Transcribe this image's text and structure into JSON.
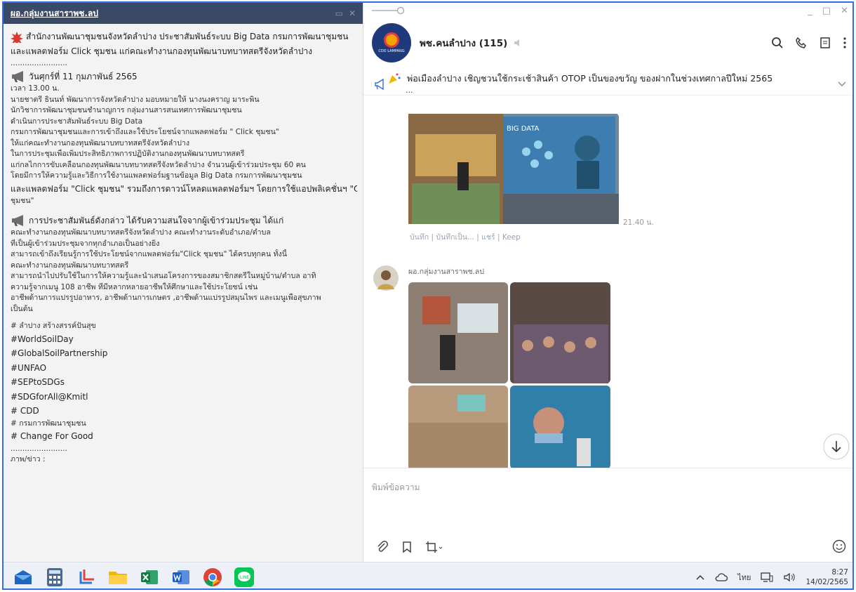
{
  "note_window": {
    "title": "ผอ.กลุ่มงานสาราพช.ลป",
    "lines": [
      {
        "kind": "big",
        "icon": "starburst",
        "text": "สำนักงานพัฒนาชุมชนจังหวัดลำปาง ประชาสัมพันธ์ระบบ Big Data กรมการพัฒนาชุมชน"
      },
      {
        "kind": "big",
        "icon": "",
        "text": "และแพลตฟอร์ม Click ชุมชน แก่คณะทำงานกองทุนพัฒนาบทบาทสตรีจังหวัดลำปาง"
      },
      {
        "kind": "normal",
        "icon": "",
        "text": "........................"
      },
      {
        "kind": "big",
        "icon": "megaphone",
        "text": "วันศุกร์ที่ 11 กุมภาพันธ์ 2565"
      },
      {
        "kind": "normal",
        "icon": "",
        "text": "เวลา 13.00 น."
      },
      {
        "kind": "normal",
        "icon": "",
        "text": "นายชาตรี ธินนท์ พัฒนาการจังหวัดลำปาง มอบหมายให้ นางนงคราญ มาระพิน"
      },
      {
        "kind": "normal",
        "icon": "",
        "text": "นักวิชาการพัฒนาชุมชนชำนาญการ กลุ่มงานสารสนเทศการพัฒนาชุมชน"
      },
      {
        "kind": "normal",
        "icon": "",
        "text": "ดำเนินการประชาสัมพันธ์ระบบ Big Data"
      },
      {
        "kind": "normal",
        "icon": "",
        "text": "กรมการพัฒนาชุมชนและการเข้าถึงและใช้ประโยชน์จากแพลตฟอร์ม \" Click ชุมชน\""
      },
      {
        "kind": "normal",
        "icon": "",
        "text": "ให้แก่คณะทำงานกองทุนพัฒนาบทบาทสตรีจังหวัดลำปาง"
      },
      {
        "kind": "normal",
        "icon": "",
        "text": "ในการประชุมเพื่อเพิ่มประสิทธิภาพการปฏิบัติงานกองทุนพัฒนาบทบาทสตรี"
      },
      {
        "kind": "normal",
        "icon": "",
        "text": "แก่กลไกการขับเคลื่อนกองทุนพัฒนาบทบาทสตรีจังหวัดลำปาง จำนวนผู้เข้าร่วมประชุม 60 คน"
      },
      {
        "kind": "normal",
        "icon": "",
        "text": "โดยมีการให้ความรู้และวิธีการใช้งานแพลตฟอร์มฐานข้อมูล Big Data กรมการพัฒนาชุมชน"
      },
      {
        "kind": "big",
        "icon": "",
        "text": "และแพลตฟอร์ม \"Click ชุมชน\" รวมถึงการดาวน์โหลดแพลตฟอร์มฯ โดยการใช้แอปพลิเคชั่นฯ \"Click"
      },
      {
        "kind": "normal",
        "icon": "",
        "text": "ชุมชน\""
      },
      {
        "kind": "gap",
        "icon": "",
        "text": ""
      },
      {
        "kind": "big",
        "icon": "megaphone",
        "text": "การประชาสัมพันธ์ดังกล่าว ได้รับความสนใจจากผู้เข้าร่วมประชุม ได้แก่"
      },
      {
        "kind": "normal",
        "icon": "",
        "text": "คณะทำงานกองทุนพัฒนาบทบาทสตรีจังหวัดลำปาง คณะทำงานระดับอำเภอ/ตำบล"
      },
      {
        "kind": "normal",
        "icon": "",
        "text": "ที่เป็นผู้เข้าร่วมประชุมจากทุกอำเภอเป็นอย่างยิ่ง"
      },
      {
        "kind": "normal",
        "icon": "",
        "text": "สามารถเข้าถึงเรียนรู้การใช้ประโยชน์จากแพลตฟอร์ม\"Click ชุมชน\" ได้ครบทุกคน ทั้งนี้"
      },
      {
        "kind": "normal",
        "icon": "",
        "text": "คณะทำงานกองทุนพัฒนาบทบาทสตรี"
      },
      {
        "kind": "normal",
        "icon": "",
        "text": "สามารถนำไปปรับใช้ในการให้ความรู้และนำเสนอโครงการของสมาชิกสตรีในหมู่บ้าน/ตำบล อาทิ"
      },
      {
        "kind": "normal",
        "icon": "",
        "text": "ความรู้จากเมนู 108 อาชีพ ที่มีหลากหลายอาชีพให้ศึกษาและใช้ประโยชน์ เช่น"
      },
      {
        "kind": "normal",
        "icon": "",
        "text": "อาชีพด้านการแปรรูปอาหาร, อาชีพด้านการเกษตร ,อาชีพด้านแปรรูปสมุนไพร และเมนูเพื่อสุขภาพ"
      },
      {
        "kind": "normal",
        "icon": "",
        "text": "เป็นต้น"
      },
      {
        "kind": "gap",
        "icon": "",
        "text": ""
      },
      {
        "kind": "normal",
        "icon": "",
        "text": "# ลำปาง สร้างสรรค์ปันสุข"
      },
      {
        "kind": "big",
        "icon": "",
        "text": " #WorldSoilDay"
      },
      {
        "kind": "big",
        "icon": "",
        "text": "#GlobalSoilPartnership"
      },
      {
        "kind": "big",
        "icon": "",
        "text": "#UNFAO"
      },
      {
        "kind": "big",
        "icon": "",
        "text": "#SEPtoSDGs"
      },
      {
        "kind": "big",
        "icon": "",
        "text": "#SDGforAll@Kmitl"
      },
      {
        "kind": "big",
        "icon": "",
        "text": "# CDD"
      },
      {
        "kind": "normal",
        "icon": "",
        "text": "# กรมการพัฒนาชุมชน"
      },
      {
        "kind": "big",
        "icon": "",
        "text": "#  Change For Good"
      },
      {
        "kind": "normal",
        "icon": "",
        "text": "........................"
      },
      {
        "kind": "normal",
        "icon": "",
        "text": "ภาพ/ข่าว :"
      }
    ]
  },
  "chat": {
    "group_name": "พช.คนลำปาง (115)",
    "avatar_label": "CDD LAMPANG",
    "announcement": "พ่อเมืองลำปาง เชิญชวนใช้กระเช้าสินค้า OTOP เป็นของขวัญ ของฝากในช่วงเทศกาลปีใหม่ 2565",
    "announcement_more": "...",
    "slide_title": "BIG DATA",
    "msg_time": "21.40 น.",
    "msg_actions": "บันทึก | บันทึกเป็น... | แชร์ | Keep",
    "sender_name": "ผอ.กลุ่มงานสาราพช.ลป",
    "input_placeholder": "พิมพ์ข้อความ"
  },
  "taskbar": {
    "apps": [
      "mail-app",
      "calculator-app",
      "snipping-tool-app",
      "file-explorer-app",
      "excel-app",
      "word-app",
      "chrome-app",
      "line-app"
    ],
    "language": "ไทย",
    "time": "8:27",
    "date": "14/02/2565"
  },
  "colors": {
    "title_bar": "#3a4966",
    "accent_border": "#2f6fe8",
    "line_green": "#06c755"
  }
}
